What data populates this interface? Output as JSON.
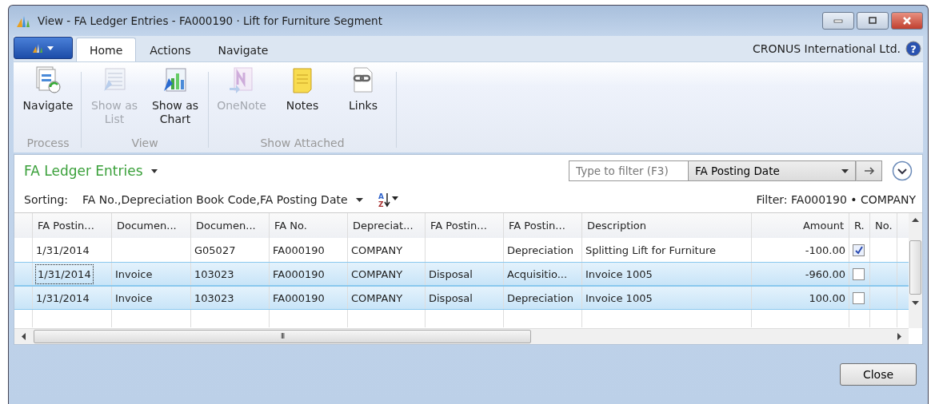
{
  "window": {
    "title": "View - FA Ledger Entries - FA000190 · Lift for Furniture Segment"
  },
  "ribbon_tabs": [
    {
      "label": "Home",
      "selected": true
    },
    {
      "label": "Actions",
      "selected": false
    },
    {
      "label": "Navigate",
      "selected": false
    }
  ],
  "company": "CRONUS International Ltd.",
  "help_glyph": "?",
  "sort_icon": {
    "top": "A",
    "bottom": "Z"
  },
  "ribbon_groups": [
    {
      "label": "Process",
      "buttons": [
        {
          "label": "Navigate",
          "kind": "navigate",
          "disabled": false
        }
      ]
    },
    {
      "label": "View",
      "buttons": [
        {
          "label": "Show as List",
          "kind": "list",
          "disabled": true
        },
        {
          "label": "Show as Chart",
          "kind": "chart",
          "disabled": false
        }
      ]
    },
    {
      "label": "Show Attached",
      "buttons": [
        {
          "label": "OneNote",
          "kind": "onenote",
          "disabled": true
        },
        {
          "label": "Notes",
          "kind": "notes",
          "disabled": false
        },
        {
          "label": "Links",
          "kind": "links",
          "disabled": false
        }
      ]
    }
  ],
  "page_title": "FA Ledger Entries",
  "filter": {
    "placeholder": "Type to filter (F3)",
    "field": "FA Posting Date"
  },
  "sorting": {
    "label": "Sorting:",
    "value": "FA No.,Depreciation Book Code,FA Posting Date"
  },
  "filter_text": "Filter: FA000190 • COMPANY",
  "table": {
    "columns": [
      "FA Postin...",
      "Documen...",
      "Documen...",
      "FA No.",
      "Depreciat...",
      "FA Postin...",
      "FA Postin...",
      "Description",
      "Amount",
      "R.",
      "No."
    ],
    "rows": [
      {
        "selected": false,
        "focused": false,
        "cells": [
          "1/31/2014",
          "",
          "G05027",
          "FA000190",
          "COMPANY",
          "",
          "Depreciation",
          "Splitting Lift for Furniture",
          "-100.00"
        ],
        "checked": true
      },
      {
        "selected": true,
        "focused": true,
        "cells": [
          "1/31/2014",
          "Invoice",
          "103023",
          "FA000190",
          "COMPANY",
          "Disposal",
          "Acquisitio...",
          "Invoice 1005",
          "-960.00"
        ],
        "checked": false
      },
      {
        "selected": true,
        "focused": false,
        "cells": [
          "1/31/2014",
          "Invoice",
          "103023",
          "FA000190",
          "COMPANY",
          "Disposal",
          "Depreciation",
          "Invoice 1005",
          "100.00"
        ],
        "checked": false
      }
    ]
  },
  "scroll_grip": "III",
  "buttons": [
    "Close"
  ]
}
